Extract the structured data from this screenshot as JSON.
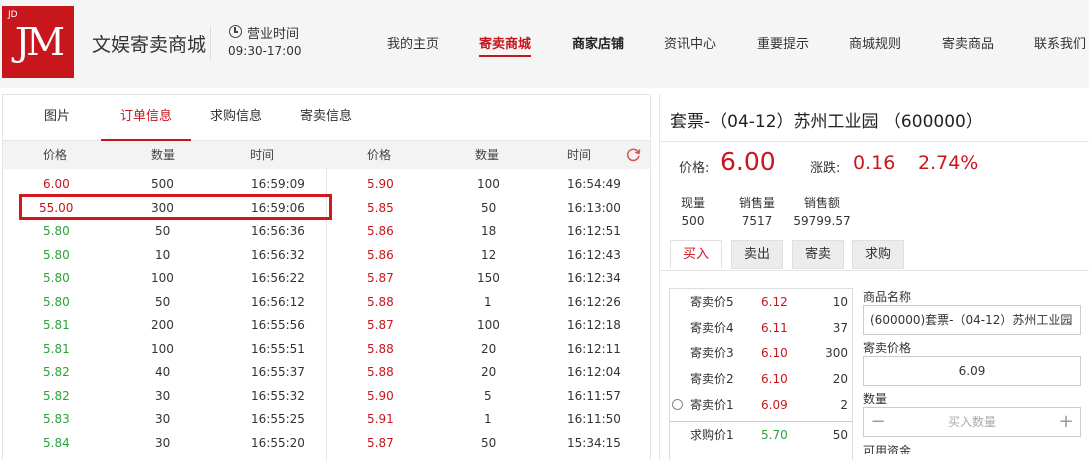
{
  "header": {
    "logo_small": "JD",
    "logo_main": "JM",
    "site_name": "文娱寄卖商城",
    "hours_label": "营业时间",
    "hours_value": "09:30-17:00",
    "nav": [
      "我的主页",
      "寄卖商城",
      "商家店铺",
      "资讯中心",
      "重要提示",
      "商城规则",
      "寄卖商品",
      "联系我们"
    ]
  },
  "left": {
    "tabs": [
      "图片",
      "订单信息",
      "求购信息",
      "寄卖信息"
    ],
    "columns": [
      "价格",
      "数量",
      "时间",
      "价格",
      "数量",
      "时间"
    ],
    "rows_left": [
      {
        "price": "6.00",
        "qty": "500",
        "time": "16:59:09",
        "color": "red"
      },
      {
        "price": "55.00",
        "qty": "300",
        "time": "16:59:06",
        "color": "red"
      },
      {
        "price": "5.80",
        "qty": "50",
        "time": "16:56:36",
        "color": "green"
      },
      {
        "price": "5.80",
        "qty": "10",
        "time": "16:56:32",
        "color": "green"
      },
      {
        "price": "5.80",
        "qty": "100",
        "time": "16:56:22",
        "color": "green"
      },
      {
        "price": "5.80",
        "qty": "50",
        "time": "16:56:12",
        "color": "green"
      },
      {
        "price": "5.81",
        "qty": "200",
        "time": "16:55:56",
        "color": "green"
      },
      {
        "price": "5.81",
        "qty": "100",
        "time": "16:55:51",
        "color": "green"
      },
      {
        "price": "5.82",
        "qty": "40",
        "time": "16:55:37",
        "color": "green"
      },
      {
        "price": "5.82",
        "qty": "30",
        "time": "16:55:32",
        "color": "green"
      },
      {
        "price": "5.83",
        "qty": "30",
        "time": "16:55:25",
        "color": "green"
      },
      {
        "price": "5.84",
        "qty": "30",
        "time": "16:55:20",
        "color": "green"
      }
    ],
    "rows_right": [
      {
        "price": "5.90",
        "qty": "100",
        "time": "16:54:49"
      },
      {
        "price": "5.85",
        "qty": "50",
        "time": "16:13:00"
      },
      {
        "price": "5.86",
        "qty": "18",
        "time": "16:12:51"
      },
      {
        "price": "5.86",
        "qty": "12",
        "time": "16:12:43"
      },
      {
        "price": "5.87",
        "qty": "150",
        "time": "16:12:34"
      },
      {
        "price": "5.88",
        "qty": "1",
        "time": "16:12:26"
      },
      {
        "price": "5.87",
        "qty": "100",
        "time": "16:12:18"
      },
      {
        "price": "5.88",
        "qty": "20",
        "time": "16:12:11"
      },
      {
        "price": "5.88",
        "qty": "20",
        "time": "16:12:04"
      },
      {
        "price": "5.90",
        "qty": "5",
        "time": "16:11:57"
      },
      {
        "price": "5.91",
        "qty": "1",
        "time": "16:11:50"
      },
      {
        "price": "5.87",
        "qty": "50",
        "time": "15:34:15"
      }
    ]
  },
  "right": {
    "title": "套票-（04-12）苏州工业园 （600000）",
    "price_label": "价格:",
    "price_value": "6.00",
    "change_label": "涨跌:",
    "change_value": "0.16",
    "change_pct": "2.74%",
    "stats": [
      {
        "label": "现量",
        "value": "500"
      },
      {
        "label": "销售量",
        "value": "7517"
      },
      {
        "label": "销售额",
        "value": "59799.57"
      }
    ],
    "trade_tabs": [
      "买入",
      "卖出",
      "寄卖",
      "求购"
    ],
    "book": [
      {
        "label": "寄卖价5",
        "price": "6.12",
        "qty": "10"
      },
      {
        "label": "寄卖价4",
        "price": "6.11",
        "qty": "37"
      },
      {
        "label": "寄卖价3",
        "price": "6.10",
        "qty": "300"
      },
      {
        "label": "寄卖价2",
        "price": "6.10",
        "qty": "20"
      },
      {
        "label": "寄卖价1",
        "price": "6.09",
        "qty": "2"
      },
      {
        "label": "求购价1",
        "price": "5.70",
        "qty": "50"
      }
    ],
    "form": {
      "name_label": "商品名称",
      "name_value": "(600000)套票-（04-12）苏州工业园",
      "price_label": "寄卖价格",
      "price_value": "6.09",
      "qty_label": "数量",
      "qty_placeholder": "买入数量",
      "minus": "−",
      "plus": "+",
      "cut_label": "可用资金"
    }
  },
  "colors": {
    "accent": "#c8161d",
    "up": "#c8161d",
    "down": "#2aa43a"
  }
}
